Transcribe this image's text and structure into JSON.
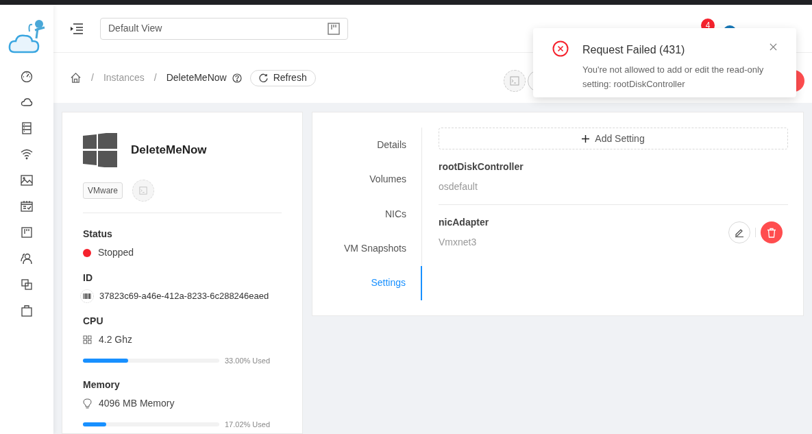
{
  "header": {
    "view_select": {
      "value": "Default View"
    },
    "notification_count": "4"
  },
  "breadcrumb": {
    "separator": "/",
    "items": [
      "Instances",
      "DeleteMeNow"
    ],
    "refresh_button": "Refresh"
  },
  "toast": {
    "title": "Request Failed (431)",
    "message": "You're not allowed to add or edit the read-only setting: rootDiskController"
  },
  "instance": {
    "name": "DeleteMeNow",
    "hypervisor": "VMware",
    "fields": [
      {
        "kind": "status",
        "label": "Status",
        "value": "Stopped",
        "color": "#f5222d"
      },
      {
        "kind": "id",
        "label": "ID",
        "value": "37823c69-a46e-412a-8233-6c288246eaed"
      },
      {
        "kind": "usage",
        "label": "CPU",
        "value": "4.2 Ghz",
        "level": 0.33,
        "reading": "33.00% Used"
      },
      {
        "kind": "usage",
        "label": "Memory",
        "value": "4096 MB Memory",
        "level": 0.17,
        "reading": "17.02% Used"
      }
    ]
  },
  "tabs": [
    {
      "label": "Details",
      "selected": false
    },
    {
      "label": "Volumes",
      "selected": false
    },
    {
      "label": "NICs",
      "selected": false
    },
    {
      "label": "VM Snapshots",
      "selected": false
    },
    {
      "label": "Settings",
      "selected": true
    }
  ],
  "add_setting_button": "Add Setting",
  "settings": [
    {
      "name": "rootDiskController",
      "value": "osdefault",
      "editable": false
    },
    {
      "name": "nicAdapter",
      "value": "Vmxnet3",
      "editable": true
    }
  ]
}
